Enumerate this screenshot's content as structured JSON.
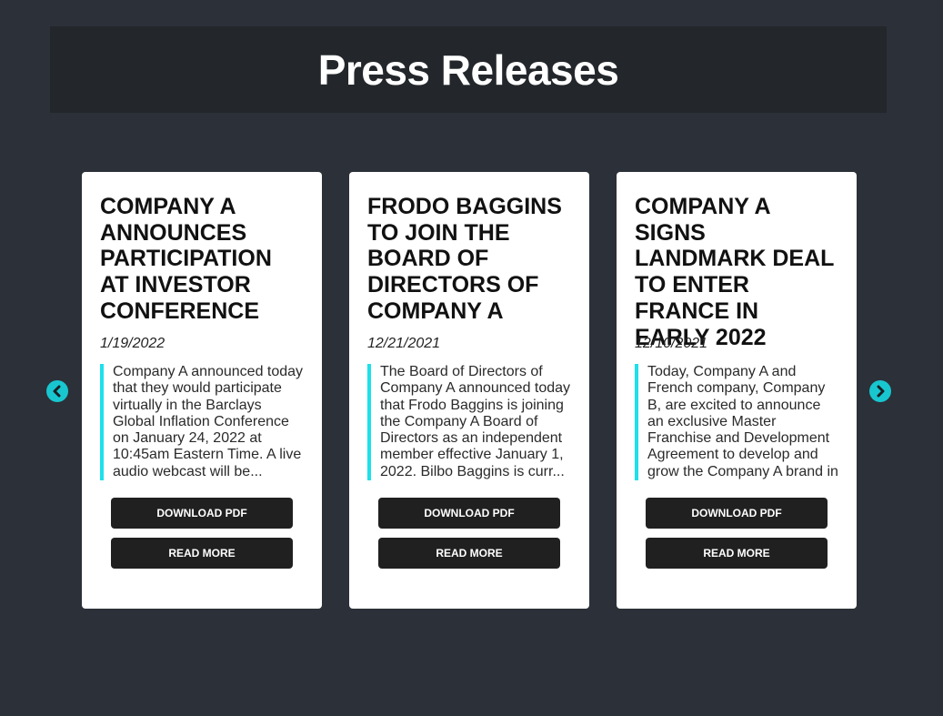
{
  "page": {
    "title": "Press Releases"
  },
  "carousel": {
    "prev_icon": "chevron-left-icon",
    "next_icon": "chevron-right-icon",
    "accent_color": "#18c6cf"
  },
  "cards": [
    {
      "title": "COMPANY A ANNOUNCES PARTICIPATION AT INVESTOR CONFERENCE",
      "date": "1/19/2022",
      "excerpt": "Company A announced today that they would participate virtually in the Barclays Global Inflation Conference on January 24, 2022 at 10:45am Eastern Time. A live audio webcast will be...",
      "download_label": "DOWNLOAD PDF",
      "read_more_label": "READ MORE"
    },
    {
      "title": "FRODO BAGGINS TO JOIN THE BOARD OF DIRECTORS OF COMPANY A",
      "date": "12/21/2021",
      "excerpt": "The Board of Directors of Company A announced today that Frodo Baggins is joining the Company A Board of Directors as an independent member effective January 1, 2022. Bilbo Baggins is curr...",
      "download_label": "DOWNLOAD PDF",
      "read_more_label": "READ MORE"
    },
    {
      "title": "COMPANY A SIGNS LANDMARK DEAL TO ENTER FRANCE IN EARLY 2022",
      "date": "12/10/2021",
      "excerpt": "Today, Company A and French company, Company B, are excited to announce an exclusive Master Franchise and Development Agreement to develop and grow the Company A brand in Fra...",
      "download_label": "DOWNLOAD PDF",
      "read_more_label": "READ MORE"
    }
  ]
}
